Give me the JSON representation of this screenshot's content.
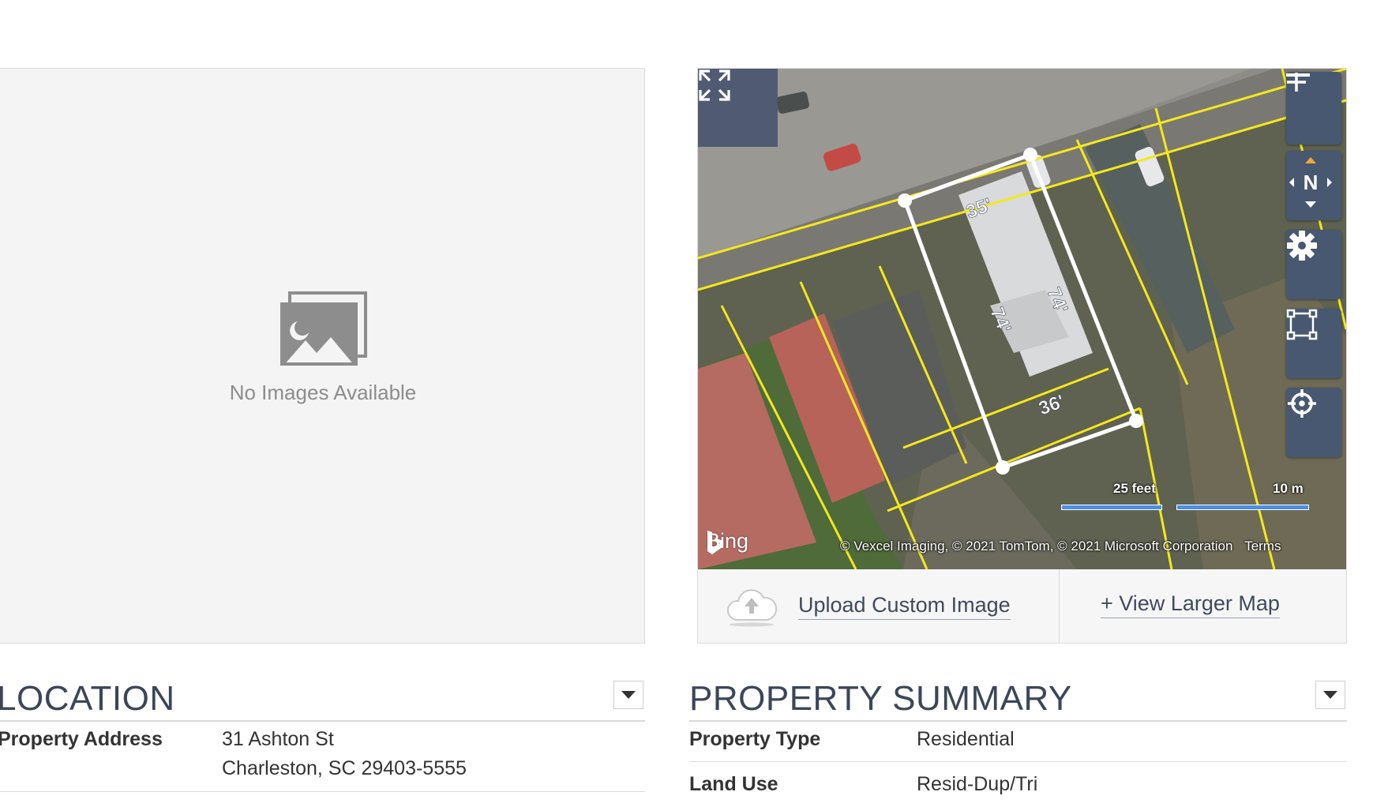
{
  "photo_panel": {
    "empty_icon": "image-placeholder-icon",
    "empty_text": "No Images Available"
  },
  "map": {
    "provider": "Bing",
    "attribution": "© Vexcel Imaging, © 2021 TomTom, © 2021 Microsoft Corporation",
    "terms_label": "Terms",
    "scale_feet": "25 feet",
    "scale_meters": "10 m",
    "parcel_dimensions": {
      "front": "35'",
      "back": "36'",
      "left_side": "74'",
      "right_side": "74'"
    },
    "compass_label": "N",
    "controls": {
      "zoom_in_icon": "plus-icon",
      "zoom_out_icon": "minus-icon",
      "compass_icon": "compass-icon",
      "settings_icon": "gear-icon",
      "select_icon": "select-area-icon",
      "locate_icon": "crosshair-icon",
      "fullscreen_icon": "expand-icon"
    },
    "accent_color": "#475870",
    "parcel_line_color": "#f4e81c"
  },
  "map_footer": {
    "upload_label": "Upload Custom Image",
    "upload_icon": "cloud-upload-icon",
    "view_larger_label": "+ View Larger Map"
  },
  "location": {
    "title": "LOCATION",
    "rows": [
      {
        "label": "Property Address",
        "value_line1": "31 Ashton St",
        "value_line2": "Charleston, SC 29403-5555"
      }
    ]
  },
  "property_summary": {
    "title": "PROPERTY SUMMARY",
    "rows": [
      {
        "label": "Property Type",
        "value": "Residential"
      },
      {
        "label": "Land Use",
        "value": "Resid-Dup/Tri"
      }
    ]
  }
}
